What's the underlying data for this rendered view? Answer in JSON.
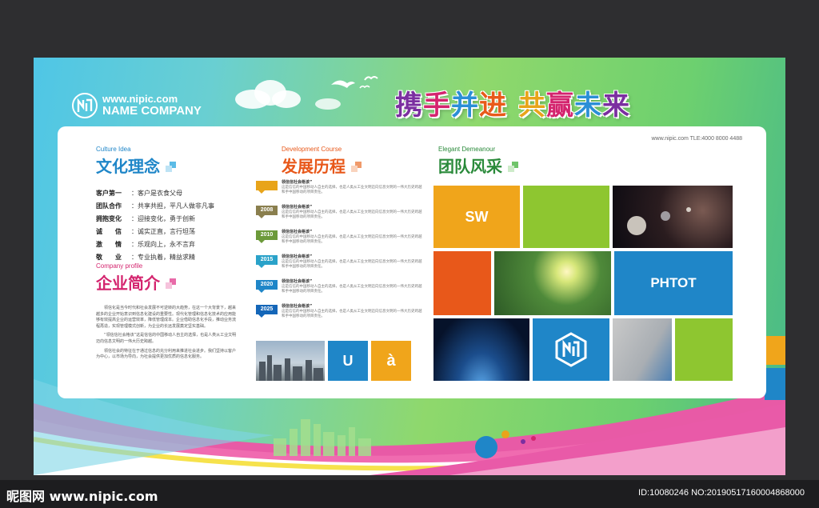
{
  "brand": {
    "url": "www.nipic.com",
    "name": "NAME COMPANY"
  },
  "slogan": {
    "chars": [
      {
        "t": "携",
        "c": "#7b2fa0"
      },
      {
        "t": "手",
        "c": "#d4246e"
      },
      {
        "t": "并",
        "c": "#2b8fd6"
      },
      {
        "t": "进",
        "c": "#e85a1a"
      },
      {
        "t": " ",
        "c": "#ffffff"
      },
      {
        "t": "共",
        "c": "#e8a41a"
      },
      {
        "t": "赢",
        "c": "#d4246e"
      },
      {
        "t": "未",
        "c": "#2b8fd6"
      },
      {
        "t": "来",
        "c": "#7b2fa0"
      }
    ]
  },
  "contact": "www.nipic.com   TLE:4000 8000 4488",
  "culture": {
    "en": "Culture Idea",
    "cn": "文化理念",
    "items": [
      {
        "k": "客户第一",
        "v": "：客户是衣食父母"
      },
      {
        "k": "团队合作",
        "v": "：共享共担，平凡人做非凡事"
      },
      {
        "k": "拥抱变化",
        "v": "：迎接变化，勇于创新"
      },
      {
        "k": "诚　　信",
        "v": "：诚实正直，言行坦荡"
      },
      {
        "k": "激　　情",
        "v": "：乐观向上，永不言弃"
      },
      {
        "k": "敬　　业",
        "v": "：专业执着，精益求精"
      }
    ]
  },
  "profile": {
    "en": "Company profile",
    "cn": "企业简介",
    "paras": [
      "领信化是当今时代和社会发展不可逆转的大趋势，在这一个大背景下，越来越多的企业开始意识到信息化建设的重要性。现代化管理和信息化技术的应用能够有效提高企业的运营效率，降低管理成本。企业借助信息化手段，推动业务流程再造，实现管理模式创新，为企业的长远发展奠定坚实基础。",
      "“领信信社会格该”这是信信的中国移动人自主的选择，也是人类从工业文明迈向信息文明的一伟大历史跨越。",
      "领信社会的特征在于通过信息的充分利用来推进社会进步。我们坚持以客户为中心，以市场为导向，为社会提供更加优质的信息化服务。"
    ]
  },
  "development": {
    "en": "Development Course",
    "cn": "发展历程",
    "items": [
      {
        "year": "",
        "color": "#e8a41a",
        "title": "领信信社会格该”",
        "desc": "这是信信的中国移动人自主的选择，也是人类从工业文明迈向信息文明的一伟大历史跨越和手中国移动的项目责任。"
      },
      {
        "year": "2008",
        "color": "#8a7f4e",
        "title": "领信信社会格该”",
        "desc": "这是信信的中国移动人自主的选择，也是人类从工业文明迈向信息文明的一伟大历史跨越和手中国移动的项目责任。"
      },
      {
        "year": "2010",
        "color": "#6c9a3a",
        "title": "领信信社会格该”",
        "desc": "这是信信的中国移动人自主的选择，也是人类从工业文明迈向信息文明的一伟大历史跨越和手中国移动的项目责任。"
      },
      {
        "year": "2015",
        "color": "#2aa2c9",
        "title": "领信信社会格该”",
        "desc": "这是信信的中国移动人自主的选择，也是人类从工业文明迈向信息文明的一伟大历史跨越和手中国移动的项目责任。"
      },
      {
        "year": "2020",
        "color": "#1f86c8",
        "title": "领信信社会格该”",
        "desc": "这是信信的中国移动人自主的选择，也是人类从工业文明迈向信息文明的一伟大历史跨越和手中国移动的项目责任。"
      },
      {
        "year": "2025",
        "color": "#1466b8",
        "title": "领信信社会格该”",
        "desc": "这是信信的中国移动人自主的选择，也是人类从工业文明迈向信息文明的一伟大历史跨越和手中国移动的项目责任。"
      }
    ],
    "tiles": [
      {
        "label": "",
        "color": "#7f8ea3"
      },
      {
        "label": "U",
        "color": "#1f86c8"
      },
      {
        "label": "à",
        "color": "#f0a51b"
      }
    ]
  },
  "team": {
    "en": "Elegant Demeanour",
    "cn": "团队风采",
    "tile_sw": "SW",
    "tile_phtot": "PHTOT",
    "colors": {
      "orange": "#f0a51b",
      "green": "#8ec630",
      "blue": "#1f86c8",
      "red": "#e8581a",
      "lime": "#8ec630"
    }
  },
  "footer": {
    "site": "昵图网 www.nipic.com",
    "id": "ID:10080246 NO:20190517160004868000"
  }
}
